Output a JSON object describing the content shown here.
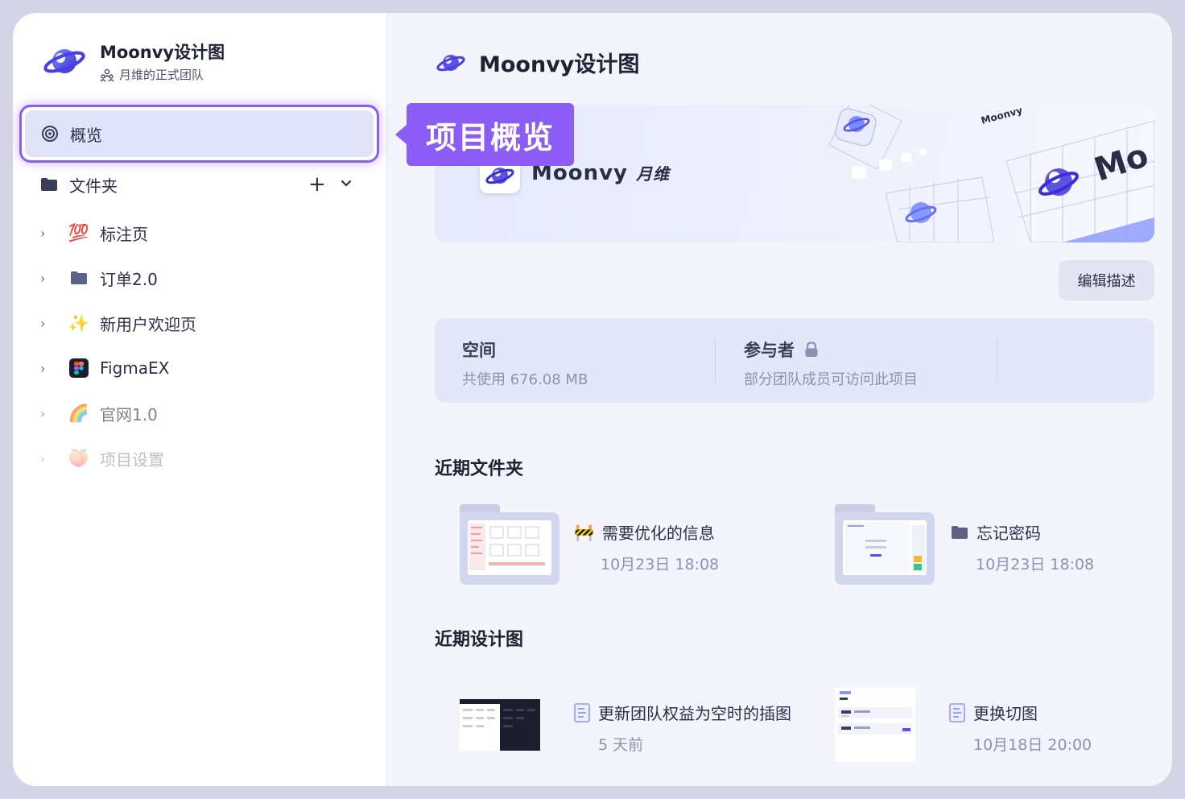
{
  "team": {
    "name": "Moonvy设计图",
    "subtitle": "月维的正式团队"
  },
  "sidebar": {
    "overview_label": "概览",
    "folders_label": "文件夹",
    "add_symbol": "+",
    "items": [
      {
        "label": "标注页",
        "icon": "💯"
      },
      {
        "label": "订单2.0",
        "icon": "folder-icon"
      },
      {
        "label": "新用户欢迎页",
        "icon": "✨"
      },
      {
        "label": "FigmaEX",
        "icon": "figma-icon"
      },
      {
        "label": "官网1.0",
        "icon": "🌈"
      },
      {
        "label": "项目设置",
        "icon": "🍑"
      }
    ]
  },
  "main": {
    "project_title": "Moonvy设计图",
    "banner_brand": "Moonvy",
    "banner_brand_cn": "月维",
    "tooltip": "项目概览",
    "edit_button": "编辑描述",
    "info": {
      "space_title": "空间",
      "space_value": "共使用 676.08 MB",
      "members_title": "参与者",
      "members_value": "部分团队成员可访问此项目"
    },
    "recent_folders_title": "近期文件夹",
    "recent_folders": [
      {
        "name": "需要优化的信息",
        "icon": "🚧",
        "time": "10月23日 18:08"
      },
      {
        "name": "忘记密码",
        "icon": "folder-icon",
        "time": "10月23日 18:08"
      }
    ],
    "recent_designs_title": "近期设计图",
    "recent_designs": [
      {
        "name": "更新团队权益为空时的插图",
        "time": "5 天前"
      },
      {
        "name": "更换切图",
        "time": "10月18日 20:00"
      }
    ]
  },
  "colors": {
    "accent": "#8b5cf6",
    "brand": "#5b52e6"
  }
}
